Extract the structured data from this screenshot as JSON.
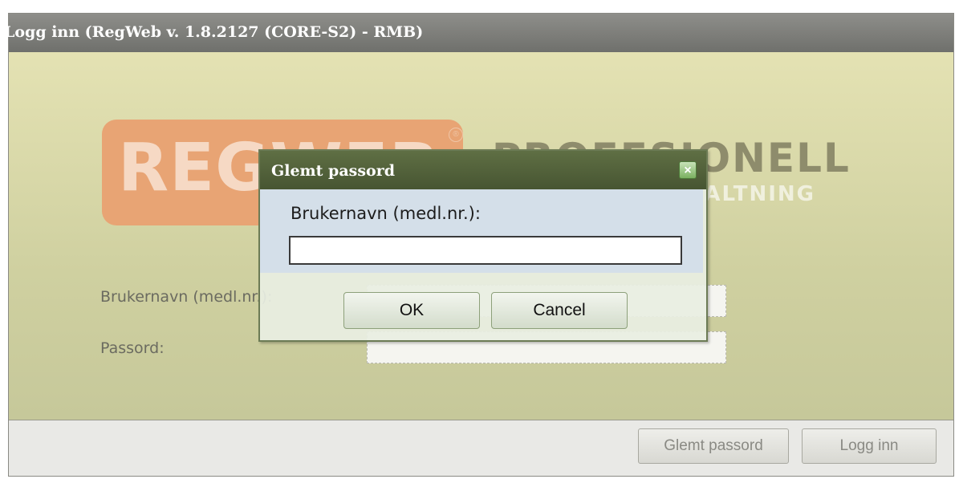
{
  "window": {
    "title": "Logg inn (RegWeb v. 1.8.2127 (CORE-S2) - RMB)"
  },
  "logo": {
    "brand": "REGWEB",
    "reg_mark": "®",
    "tagline_line1": "PROFESJONELL",
    "tagline_line2": "VALTNING"
  },
  "login_form": {
    "username_label": "Brukernavn (medl.nr.):",
    "password_label": "Passord:",
    "username_value": "",
    "password_value": ""
  },
  "footer": {
    "forgot_password_button": "Glemt passord",
    "login_button": "Logg inn"
  },
  "dialog": {
    "title": "Glemt passord",
    "close_icon": "close-icon",
    "username_label": "Brukernavn (medl.nr.):",
    "username_value": "",
    "ok_button": "OK",
    "cancel_button": "Cancel"
  },
  "colors": {
    "titlebar": "#7e7f7b",
    "content_bg": "#cfd0a0",
    "logo_orange": "#e8a474",
    "dialog_title": "#536140",
    "dialog_body": "#d4dfe9"
  }
}
